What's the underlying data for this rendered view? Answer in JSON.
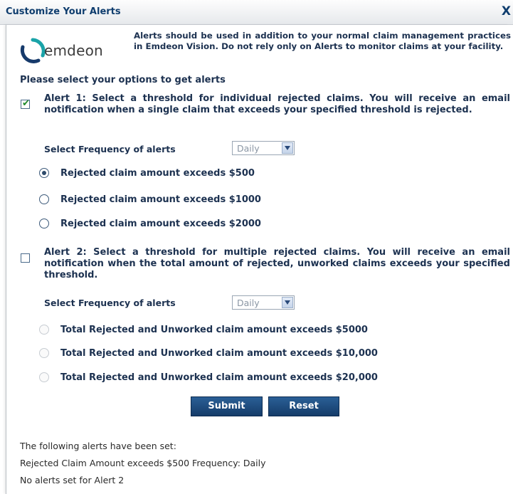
{
  "dialog": {
    "title": "Customize Your Alerts",
    "close_label": "X"
  },
  "logo": {
    "brand_text": "emdeon",
    "tm": "·",
    "colors": {
      "teal": "#1aa3a8",
      "navy": "#163a6b"
    }
  },
  "notice": "Alerts should be used in addition to your normal claim management practices in Emdeon Vision. Do not rely only on Alerts to monitor claims at your facility.",
  "select_heading": "Please select your options to get alerts",
  "alert1": {
    "checked": true,
    "text": "Alert 1: Select a threshold for individual rejected claims. You will receive an email notification when a single claim that exceeds your specified threshold is rejected.",
    "frequency_label": "Select Frequency of alerts",
    "frequency_value": "Daily",
    "options": [
      {
        "label": "Rejected claim amount exceeds $500",
        "selected": true
      },
      {
        "label": "Rejected claim amount exceeds $1000",
        "selected": false
      },
      {
        "label": "Rejected claim amount exceeds $2000",
        "selected": false
      }
    ]
  },
  "alert2": {
    "checked": false,
    "text": "Alert 2: Select a threshold for multiple rejected claims. You will receive an email notification when the total amount of rejected, unworked claims exceeds your specified threshold.",
    "frequency_label": "Select Frequency of alerts",
    "frequency_value": "Daily",
    "options": [
      {
        "label": "Total Rejected and Unworked claim amount exceeds $5000",
        "selected": false
      },
      {
        "label": "Total Rejected and Unworked claim amount exceeds $10,000",
        "selected": false
      },
      {
        "label": "Total Rejected and Unworked claim amount exceeds $20,000",
        "selected": false
      }
    ]
  },
  "buttons": {
    "submit": "Submit",
    "reset": "Reset"
  },
  "status": {
    "heading": "The following alerts have been set:",
    "line1": "Rejected Claim Amount exceeds $500 Frequency: Daily",
    "line2": "No alerts set for Alert 2"
  }
}
